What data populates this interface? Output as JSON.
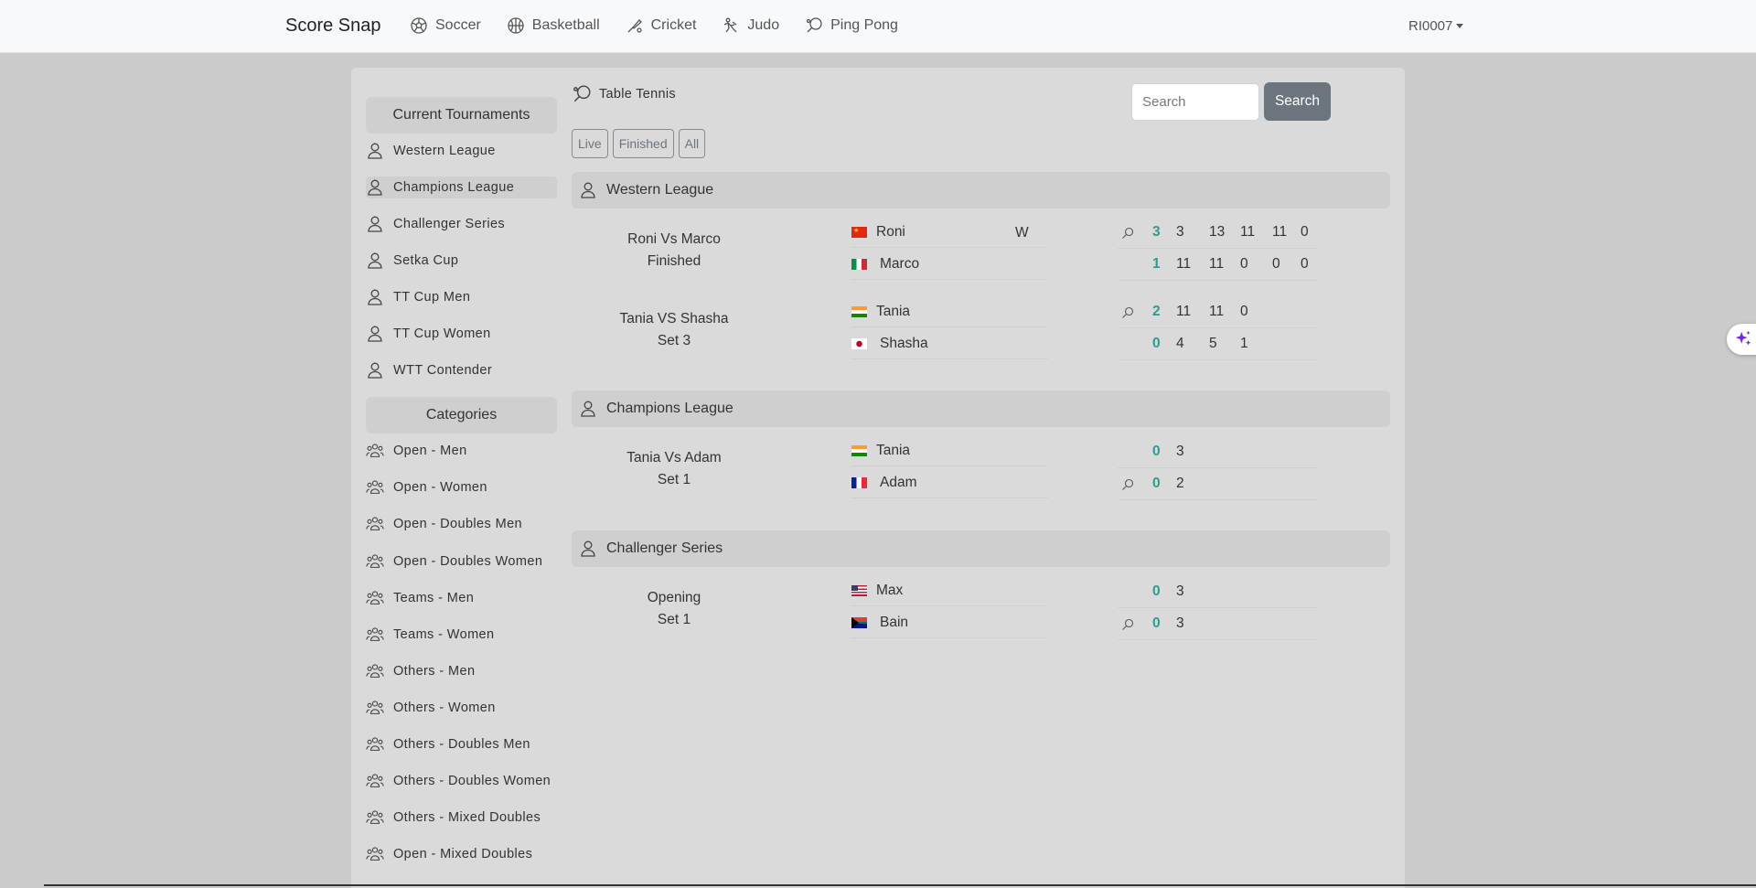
{
  "navbar": {
    "brand": "Score Snap",
    "items": [
      {
        "label": "Soccer",
        "icon": "soccer-ball-icon"
      },
      {
        "label": "Basketball",
        "icon": "basketball-icon"
      },
      {
        "label": "Cricket",
        "icon": "cricket-icon"
      },
      {
        "label": "Judo",
        "icon": "judo-icon"
      },
      {
        "label": "Ping Pong",
        "icon": "ping-pong-icon"
      }
    ],
    "user": "RI0007"
  },
  "sidebar": {
    "tournaments_heading": "Current Tournaments",
    "tournaments": [
      {
        "label": "Western League"
      },
      {
        "label": "Champions League"
      },
      {
        "label": "Challenger Series"
      },
      {
        "label": "Setka Cup"
      },
      {
        "label": "TT Cup Men"
      },
      {
        "label": "TT Cup Women"
      },
      {
        "label": "WTT Contender"
      }
    ],
    "categories_heading": "Categories",
    "categories": [
      {
        "label": "Open - Men"
      },
      {
        "label": "Open - Women"
      },
      {
        "label": "Open - Doubles Men"
      },
      {
        "label": "Open - Doubles Women"
      },
      {
        "label": "Teams - Men"
      },
      {
        "label": "Teams - Women"
      },
      {
        "label": "Others - Men"
      },
      {
        "label": "Others - Women"
      },
      {
        "label": "Others - Doubles Men"
      },
      {
        "label": "Others - Doubles Women"
      },
      {
        "label": "Others - Mixed Doubles"
      },
      {
        "label": "Open - Mixed Doubles"
      }
    ]
  },
  "main": {
    "sport_title": "Table Tennis",
    "filters": [
      "Live",
      "Finished",
      "All"
    ],
    "search": {
      "placeholder": "Search",
      "button": "Search"
    },
    "leagues": [
      {
        "name": "Western League",
        "matches": [
          {
            "title": "Roni Vs Marco",
            "status": "Finished",
            "players": [
              {
                "name": "Roni",
                "flag": "china",
                "result": "W",
                "serving": true,
                "total": "3",
                "sets": [
                  "3",
                  "13",
                  "11",
                  "11",
                  "0"
                ]
              },
              {
                "name": "Marco",
                "flag": "italy",
                "result": "",
                "serving": false,
                "total": "1",
                "sets": [
                  "11",
                  "11",
                  "0",
                  "0",
                  "0"
                ]
              }
            ]
          },
          {
            "title": "Tania VS Shasha",
            "status": "Set 3",
            "players": [
              {
                "name": "Tania",
                "flag": "india",
                "result": "",
                "serving": true,
                "total": "2",
                "sets": [
                  "11",
                  "11",
                  "0"
                ]
              },
              {
                "name": "Shasha",
                "flag": "japan",
                "result": "",
                "serving": false,
                "total": "0",
                "sets": [
                  "4",
                  "5",
                  "1"
                ]
              }
            ]
          }
        ]
      },
      {
        "name": "Champions League",
        "matches": [
          {
            "title": "Tania Vs Adam",
            "status": "Set 1",
            "players": [
              {
                "name": "Tania",
                "flag": "india",
                "result": "",
                "serving": false,
                "total": "0",
                "sets": [
                  "3"
                ]
              },
              {
                "name": "Adam",
                "flag": "france",
                "result": "",
                "serving": true,
                "total": "0",
                "sets": [
                  "2"
                ]
              }
            ]
          }
        ]
      },
      {
        "name": "Challenger Series",
        "matches": [
          {
            "title": "Opening",
            "status": "Set 1",
            "players": [
              {
                "name": "Max",
                "flag": "usa",
                "result": "",
                "serving": false,
                "total": "0",
                "sets": [
                  "3"
                ]
              },
              {
                "name": "Bain",
                "flag": "south-africa",
                "result": "",
                "serving": true,
                "total": "0",
                "sets": [
                  "3"
                ]
              }
            ]
          }
        ]
      }
    ]
  },
  "colors": {
    "score_total": "#2a9d8f",
    "search_button": "#6c757d",
    "ai_button": "#7c3aed"
  }
}
